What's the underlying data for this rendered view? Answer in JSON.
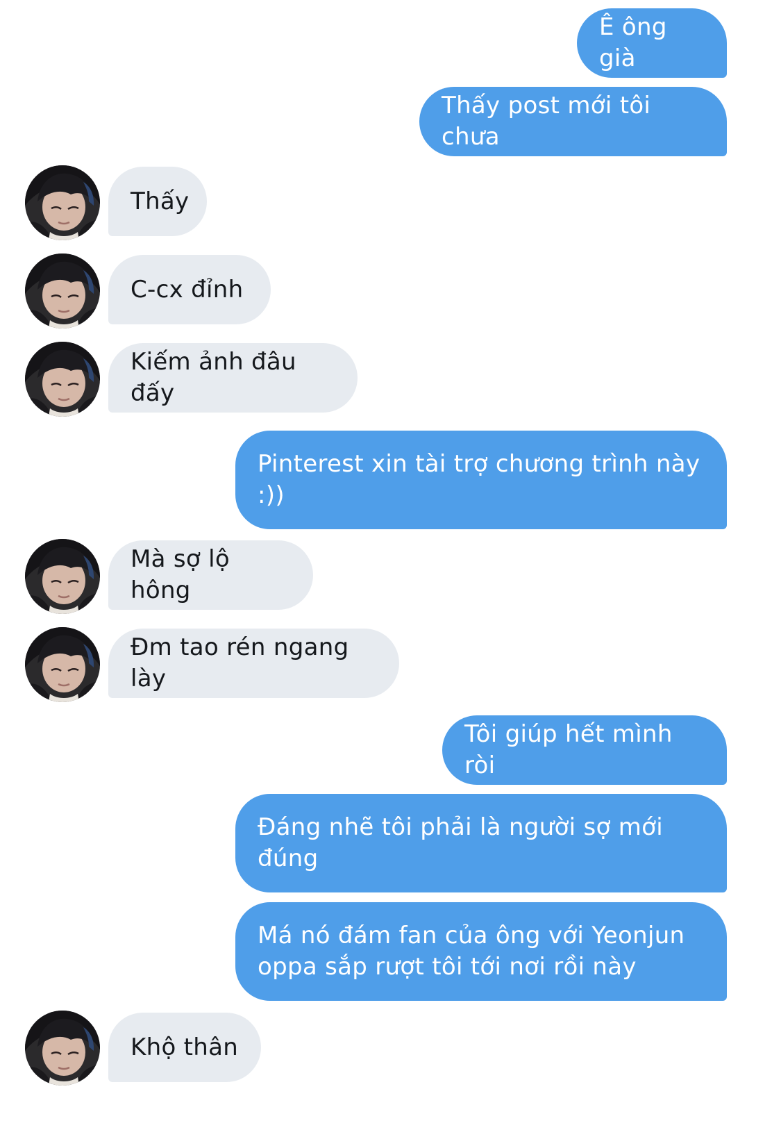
{
  "conversation": {
    "messages": [
      {
        "side": "sent",
        "text": "Ê ông già"
      },
      {
        "side": "sent",
        "text": "Thấy post mới tôi chưa"
      },
      {
        "side": "received",
        "text": "Thấy"
      },
      {
        "side": "received",
        "text": "C-cx đỉnh"
      },
      {
        "side": "received",
        "text": "Kiếm ảnh đâu đấy"
      },
      {
        "side": "sent",
        "text": "Pinterest xin tài trợ chương trình này :))"
      },
      {
        "side": "received",
        "text": "Mà sợ lộ hông"
      },
      {
        "side": "received",
        "text": "Đm tao rén ngang lày"
      },
      {
        "side": "sent",
        "text": "Tôi giúp hết mình ròi"
      },
      {
        "side": "sent",
        "text": "Đáng nhẽ tôi phải là người sợ mới đúng"
      },
      {
        "side": "sent",
        "text": "Má nó đám fan của ông với Yeonjun oppa sắp rượt tôi tới nơi rồi này"
      },
      {
        "side": "received",
        "text": "Khộ thân"
      }
    ]
  },
  "colors": {
    "sent_bubble": "#4f9ee9",
    "received_bubble": "#e7ebf0",
    "background": "#ffffff"
  }
}
